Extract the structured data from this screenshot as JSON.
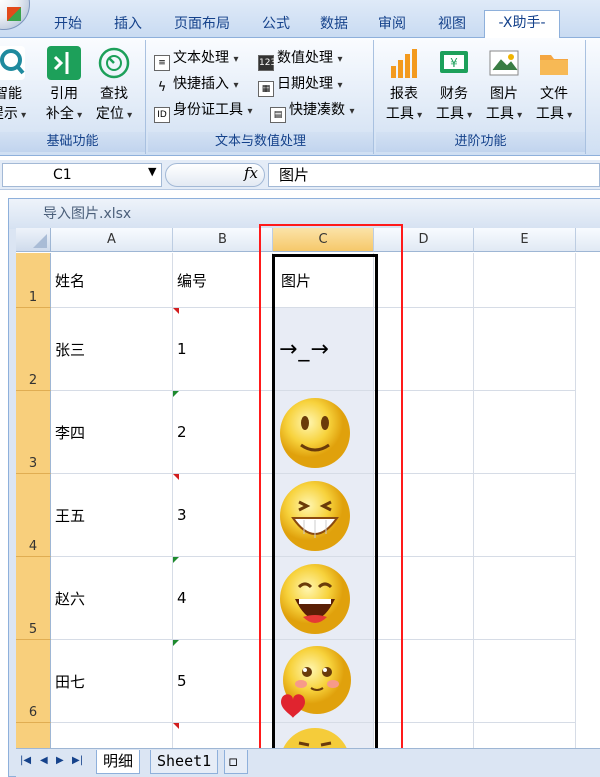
{
  "ribbon_tabs": [
    "开始",
    "插入",
    "页面布局",
    "公式",
    "数据",
    "审阅",
    "视图",
    "-X助手-"
  ],
  "groups": {
    "basic": {
      "label": "基础功能",
      "buttons": [
        {
          "line1": "智能",
          "line2": "提示"
        },
        {
          "line1": "引用",
          "line2": "补全"
        },
        {
          "line1": "查找",
          "line2": "定位"
        }
      ]
    },
    "text_data": {
      "label": "文本与数值处理",
      "buttons": [
        "文本处理",
        "数值处理",
        "快捷插入",
        "日期处理",
        "身份证工具",
        "快捷凑数"
      ]
    },
    "advanced": {
      "label": "进阶功能",
      "buttons": [
        {
          "line1": "报表",
          "line2": "工具"
        },
        {
          "line1": "财务",
          "line2": "工具"
        },
        {
          "line1": "图片",
          "line2": "工具"
        },
        {
          "line1": "文件",
          "line2": "工具"
        }
      ]
    }
  },
  "formula_bar": {
    "cell_ref": "C1",
    "fx": "fx",
    "content": "图片"
  },
  "workbook": {
    "title": "导入图片.xlsx"
  },
  "columns": [
    "A",
    "B",
    "C",
    "D",
    "E"
  ],
  "rows": [
    {
      "num": "1",
      "name": "姓名",
      "id": "编号",
      "pic": "图片"
    },
    {
      "num": "2",
      "name": "张三",
      "id": "1",
      "pic": "→_→"
    },
    {
      "num": "3",
      "name": "李四",
      "id": "2",
      "pic": "smile-emoji"
    },
    {
      "num": "4",
      "name": "王五",
      "id": "3",
      "pic": "grin-emoji"
    },
    {
      "num": "5",
      "name": "赵六",
      "id": "4",
      "pic": "laugh-emoji"
    },
    {
      "num": "6",
      "name": "田七",
      "id": "5",
      "pic": "love-emoji"
    }
  ],
  "sheets": [
    "明细",
    "Sheet1"
  ]
}
